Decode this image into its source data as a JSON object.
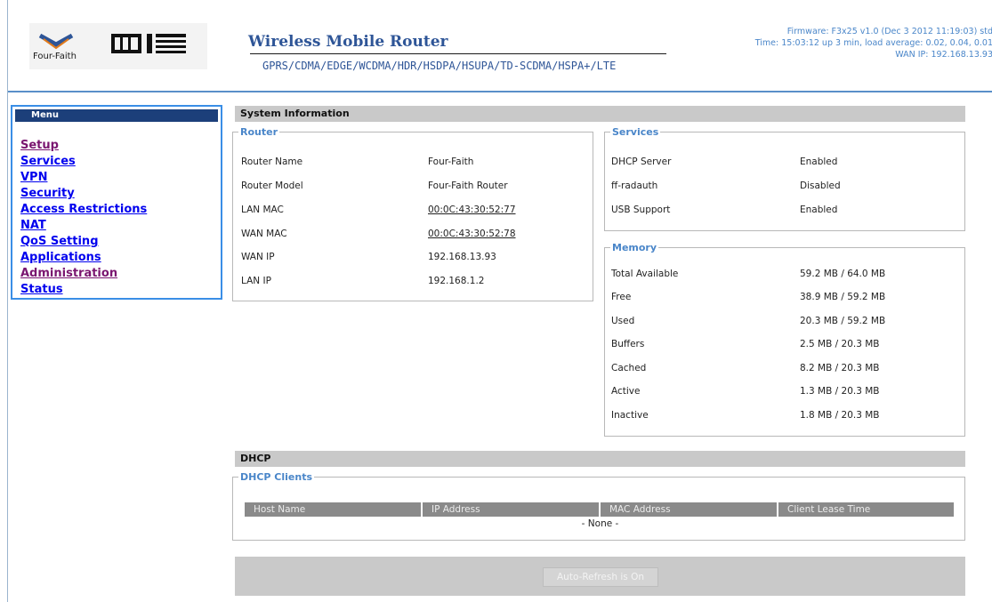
{
  "header": {
    "logo_caption": "Four-Faith",
    "product_title": "Wireless Mobile Router",
    "product_subtitle": "GPRS/CDMA/EDGE/WCDMA/HDR/HSDPA/HSUPA/TD-SCDMA/HSPA+/LTE",
    "firmware": "Firmware: F3x25 v1.0 (Dec 3 2012 11:19:03) std",
    "time": "Time: 15:03:12 up 3 min, load average: 0.02, 0.04, 0.01",
    "wan_ip": "WAN IP: 192.168.13.93"
  },
  "menu": {
    "title": "Menu",
    "items": [
      {
        "label": "Setup"
      },
      {
        "label": "Services"
      },
      {
        "label": "VPN"
      },
      {
        "label": "Security"
      },
      {
        "label": "Access Restrictions"
      },
      {
        "label": "NAT"
      },
      {
        "label": "QoS Setting"
      },
      {
        "label": "Applications"
      },
      {
        "label": "Administration"
      },
      {
        "label": "Status"
      }
    ]
  },
  "system_info": {
    "title": "System Information",
    "router": {
      "legend": "Router",
      "rows": [
        {
          "label": "Router Name",
          "value": "Four-Faith"
        },
        {
          "label": "Router Model",
          "value": "Four-Faith Router"
        },
        {
          "label": "LAN MAC",
          "value": "00:0C:43:30:52:77"
        },
        {
          "label": "WAN MAC",
          "value": "00:0C:43:30:52:78"
        },
        {
          "label": "WAN IP",
          "value": "192.168.13.93"
        },
        {
          "label": "LAN IP",
          "value": "192.168.1.2"
        }
      ]
    },
    "services": {
      "legend": "Services",
      "rows": [
        {
          "label": "DHCP Server",
          "value": "Enabled"
        },
        {
          "label": "ff-radauth",
          "value": "Disabled"
        },
        {
          "label": "USB Support",
          "value": "Enabled"
        }
      ]
    },
    "memory": {
      "legend": "Memory",
      "rows": [
        {
          "label": "Total Available",
          "value": "59.2 MB / 64.0 MB"
        },
        {
          "label": "Free",
          "value": "38.9 MB / 59.2 MB"
        },
        {
          "label": "Used",
          "value": "20.3 MB / 59.2 MB"
        },
        {
          "label": "Buffers",
          "value": "2.5 MB / 20.3 MB"
        },
        {
          "label": "Cached",
          "value": "8.2 MB / 20.3 MB"
        },
        {
          "label": "Active",
          "value": "1.3 MB / 20.3 MB"
        },
        {
          "label": "Inactive",
          "value": "1.8 MB / 20.3 MB"
        }
      ]
    }
  },
  "dhcp": {
    "title": "DHCP",
    "clients_legend": "DHCP Clients",
    "columns": [
      "Host Name",
      "IP Address",
      "MAC Address",
      "Client Lease Time"
    ],
    "empty_text": "- None -"
  },
  "footer": {
    "refresh_label": "Auto-Refresh is On"
  }
}
